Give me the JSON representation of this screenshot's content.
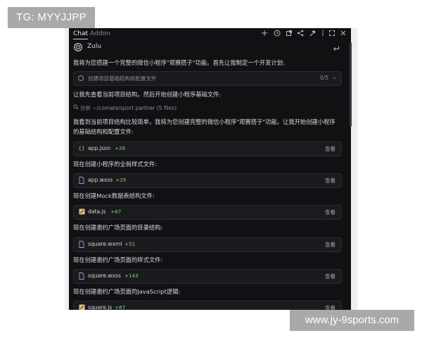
{
  "watermarks": {
    "top_left": "TG: MYYJJPP",
    "bottom_right": "www.jy-9sports.com"
  },
  "header": {
    "tabs": [
      {
        "label": "Chat",
        "active": true
      },
      {
        "label": "Addon",
        "active": false
      }
    ],
    "icons": [
      "plus-icon",
      "history-icon",
      "external-link-icon",
      "share-icon",
      "hammer-icon",
      "more-icon",
      "expand-icon",
      "close-icon"
    ]
  },
  "agent": {
    "name": "Zulu"
  },
  "messages": {
    "intro": "我将为您搭建一个完整的微信小程序\"观赛搭子\"功能。首先让我制定一个开发计划:",
    "plan_label": "创建项目基础结构和配置文件",
    "plan_count": "0/5",
    "check_structure": "让我先查看当前项目结构，然后开始创建小程序基础文件:",
    "analyze": "分析 ~/comate/sport partner (5 files)",
    "simple_line1": "我看到当前项目结构比较简单，我将为您创建完整的微信小程序\"观赛搭子\"功能。让我开始创建小程序",
    "simple_line2": "的基础结构和配置文件:",
    "global_styles": "现在创建小程序的全局样式文件:",
    "mock_data": "现在创建Mock数据表结构文件:",
    "square_dir": "现在创建邀约广场页面的目录结构:",
    "square_style": "现在创建邀约广场页面的样式文件:",
    "square_js": "现在创建邀约广场页面的JavaScript逻辑:"
  },
  "files": [
    {
      "name": "app.json",
      "added": "+26",
      "view": "查看",
      "icon": "json-icon"
    },
    {
      "name": "app.wxss",
      "added": "+29",
      "view": "查看",
      "icon": "file-icon"
    },
    {
      "name": "data.js",
      "added": "+87",
      "view": "查看",
      "icon": "js-icon"
    },
    {
      "name": "square.wxml",
      "added": "+51",
      "view": "查看",
      "icon": "file-icon"
    },
    {
      "name": "square.wxss",
      "added": "+143",
      "view": "查看",
      "icon": "file-icon"
    },
    {
      "name": "square.js",
      "added": "+87",
      "view": "查看",
      "icon": "js-icon"
    }
  ],
  "colors": {
    "panel_bg": "#111113",
    "card_bg": "#1b1b1e",
    "added_green": "#7fc97f",
    "js_yellow": "#e5c07b",
    "file_blue": "#8fa8d8"
  }
}
